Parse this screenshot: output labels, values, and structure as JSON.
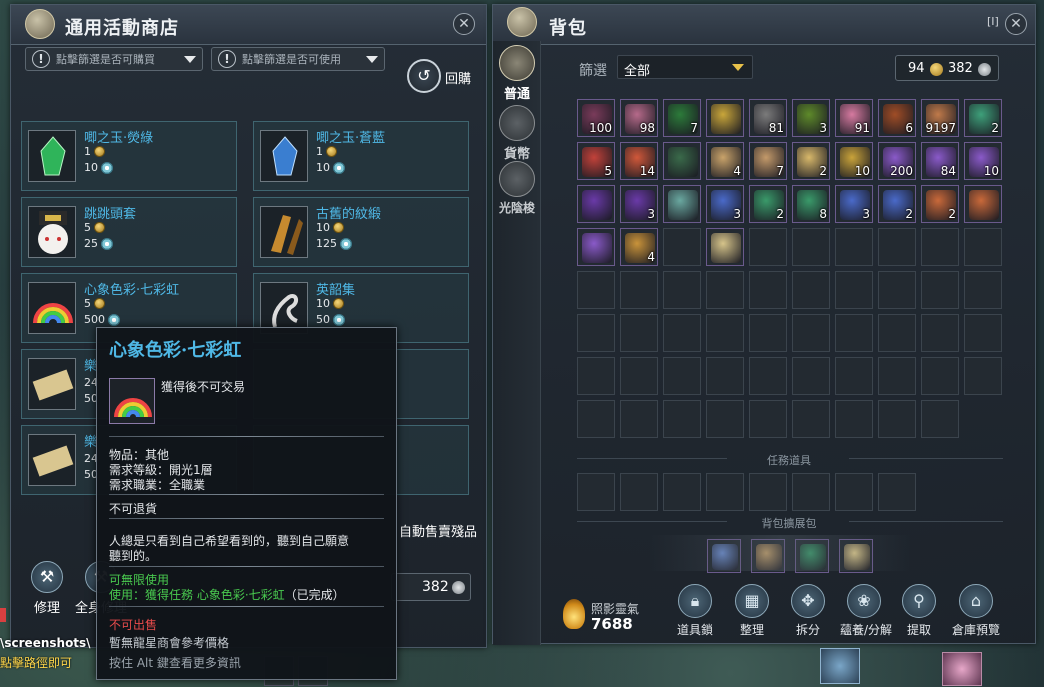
{
  "shop": {
    "title": "通用活動商店",
    "filter1": "點擊篩選是否可購買",
    "filter2": "點擊篩選是否可使用",
    "buyback": "回購",
    "items": [
      {
        "name": "唧之玉·熒綠",
        "price": "1",
        "qty": "10"
      },
      {
        "name": "唧之玉·蒼藍",
        "price": "1",
        "qty": "10"
      },
      {
        "name": "跳跳頭套",
        "price": "5",
        "qty": "25"
      },
      {
        "name": "古舊的紋緞",
        "price": "10",
        "qty": "125"
      },
      {
        "name": "心象色彩·七彩虹",
        "price": "5",
        "qty": "500"
      },
      {
        "name": "英韶集",
        "price": "10",
        "qty": "50"
      },
      {
        "name": "樂",
        "price": "",
        "qty": ""
      },
      {
        "name": "",
        "price": "",
        "qty": ""
      },
      {
        "name": "樂",
        "price": "",
        "qty": ""
      },
      {
        "name": "",
        "price": "",
        "qty": ""
      }
    ],
    "partial_numbers": [
      "24",
      "50",
      "24",
      "50"
    ],
    "auto_sell": "自動售賣殘品",
    "currency_value": "382",
    "repair_label": "修理",
    "repair_all_label": "全身修理"
  },
  "bag": {
    "title": "背包",
    "hotkey": "[I]",
    "filter_label": "篩選",
    "filter_value": "全部",
    "coins": {
      "gold": "94",
      "silver": "382"
    },
    "tabs": [
      "普通",
      "貨幣",
      "光陰梭"
    ],
    "rows": [
      [
        "100",
        "98",
        "7",
        "",
        "81",
        "3",
        "91",
        "6",
        "9197",
        "2"
      ],
      [
        "5",
        "14",
        "",
        "4",
        "7",
        "2",
        "10",
        "200",
        "84",
        "10"
      ],
      [
        "",
        "3",
        "",
        "3",
        "2",
        "8",
        "3",
        "2",
        "2",
        ""
      ],
      [
        "",
        "4",
        "",
        ""
      ]
    ],
    "quest_label": "任務道具",
    "expand_label": "背包擴展包",
    "spirit_label": "照影靈氣",
    "spirit_value": "7688",
    "actions": [
      "道具鎖",
      "整理",
      "拆分",
      "蘊養/分解",
      "提取",
      "倉庫預覽"
    ]
  },
  "tooltip": {
    "title": "心象色彩·七彩虹",
    "bind": "獲得後不可交易",
    "type": "物品：其他",
    "level": "需求等級：開光1層",
    "job": "需求職業：全職業",
    "no_refund": "不可退貨",
    "lore1": "人總是只看到自己希望看到的，聽到自己願意",
    "lore2": "聽到的。",
    "uses": "可無限使用",
    "usage_prefix": "使用：",
    "usage_link": "獲得任務 心象色彩·七彩虹",
    "usage_suffix": "（已完成）",
    "not_for_sale": "不可出售",
    "no_price": "暫無龍星商會參考價格",
    "alt_hint": "按住 Alt 鍵查看更多資訊"
  },
  "background": {
    "path_text": "\\screenshots\\",
    "hint_text": "點擊路徑即可"
  },
  "colors": {
    "accent_blue": "#4fb8e6",
    "green_text": "#49c94f",
    "red_text": "#e74b4b"
  }
}
